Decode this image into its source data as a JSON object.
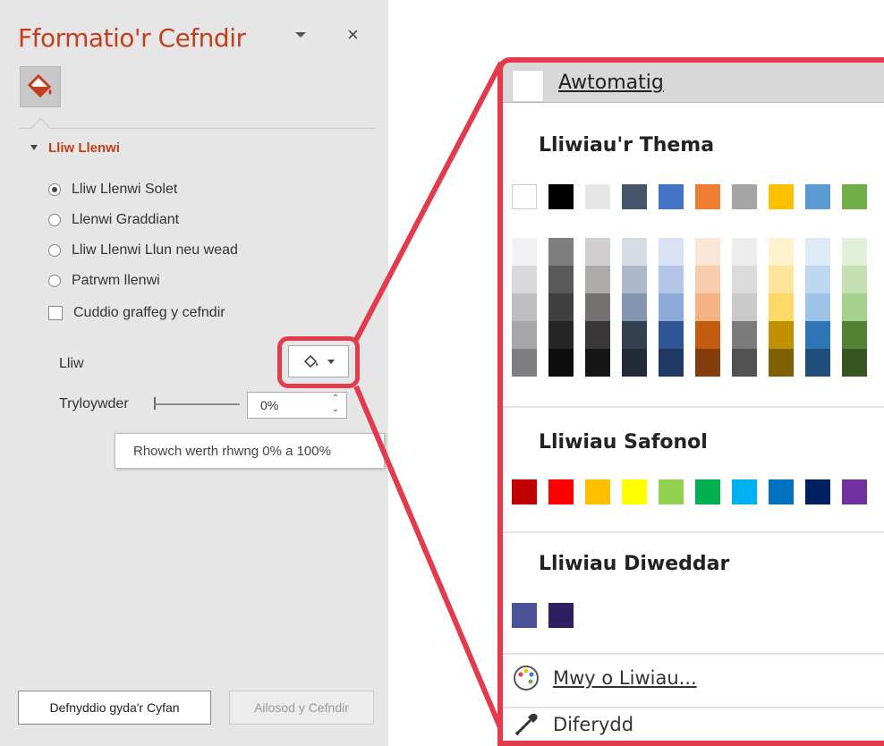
{
  "pane": {
    "title": "Fformatio'r Cefndir",
    "close_glyph": "×",
    "section_title": "Lliw Llenwi",
    "fill_options": [
      {
        "label": "Lliw Llenwi Solet",
        "selected": true
      },
      {
        "label": "Llenwi Graddiant",
        "selected": false
      },
      {
        "label": "Lliw Llenwi Llun neu wead",
        "selected": false
      },
      {
        "label": "Patrwm llenwi",
        "selected": false
      }
    ],
    "hide_checkbox_label": "Cuddio graffeg y cefndir",
    "color_label": "Lliw",
    "transparency_label": "Tryloywder",
    "transparency_value": "0%",
    "transparency_level": 0,
    "tooltip": "Rhowch werth rhwng 0% a 100%",
    "apply_all_button": "Defnyddio gyda'r Cyfan",
    "reset_button": "Ailosod y Cefndir",
    "icons": {
      "fill_tab": "paint-bucket-icon",
      "color_button": "paint-bucket-icon"
    }
  },
  "palette": {
    "automatic_label": "Awtomatig",
    "theme_heading": "Lliwiau'r Thema",
    "theme_colors": [
      "#ffffff",
      "#000000",
      "#e7e6e6",
      "#44546a",
      "#4472c4",
      "#ed7d31",
      "#a5a5a5",
      "#ffc000",
      "#5b9bd5",
      "#70ad47"
    ],
    "theme_shades": [
      [
        "#f2f2f2",
        "#d9d9d9",
        "#bfbfbf",
        "#a6a6a6",
        "#7f7f7f"
      ],
      [
        "#7f7f7f",
        "#595959",
        "#404040",
        "#262626",
        "#0d0d0d"
      ],
      [
        "#d0cece",
        "#aeaaaa",
        "#757171",
        "#3a3838",
        "#171616"
      ],
      [
        "#d6dce4",
        "#adb9ca",
        "#8496b0",
        "#333f4f",
        "#222a35"
      ],
      [
        "#d9e2f3",
        "#b4c6e7",
        "#8eaadb",
        "#2f5496",
        "#1f3864"
      ],
      [
        "#fbe5d5",
        "#f7cbac",
        "#f4b183",
        "#c55a11",
        "#833c0b"
      ],
      [
        "#ededed",
        "#dbdbdb",
        "#c9c9c9",
        "#7b7b7b",
        "#525252"
      ],
      [
        "#fff2cc",
        "#ffe599",
        "#ffd966",
        "#bf9000",
        "#7f6000"
      ],
      [
        "#deebf6",
        "#bdd7ee",
        "#9dc3e6",
        "#2e75b5",
        "#1e4e79"
      ],
      [
        "#e2efd9",
        "#c5e0b3",
        "#a8d08d",
        "#538135",
        "#375623"
      ]
    ],
    "standard_heading": "Lliwiau Safonol",
    "standard_colors": [
      "#c00000",
      "#ff0000",
      "#ffc000",
      "#ffff00",
      "#92d050",
      "#00b050",
      "#00b0f0",
      "#0070c0",
      "#002060",
      "#7030a0"
    ],
    "recent_heading": "Lliwiau Diweddar",
    "recent_colors": [
      "#4a5197",
      "#2e1f5e"
    ],
    "more_colors": "Mwy o Liwiau...",
    "eyedropper": "Diferydd",
    "icons": {
      "more_colors": "color-palette-icon",
      "eyedropper": "eyedropper-icon"
    }
  },
  "colors": {
    "accent": "#c43e1c",
    "highlight": "#e33b4c"
  }
}
